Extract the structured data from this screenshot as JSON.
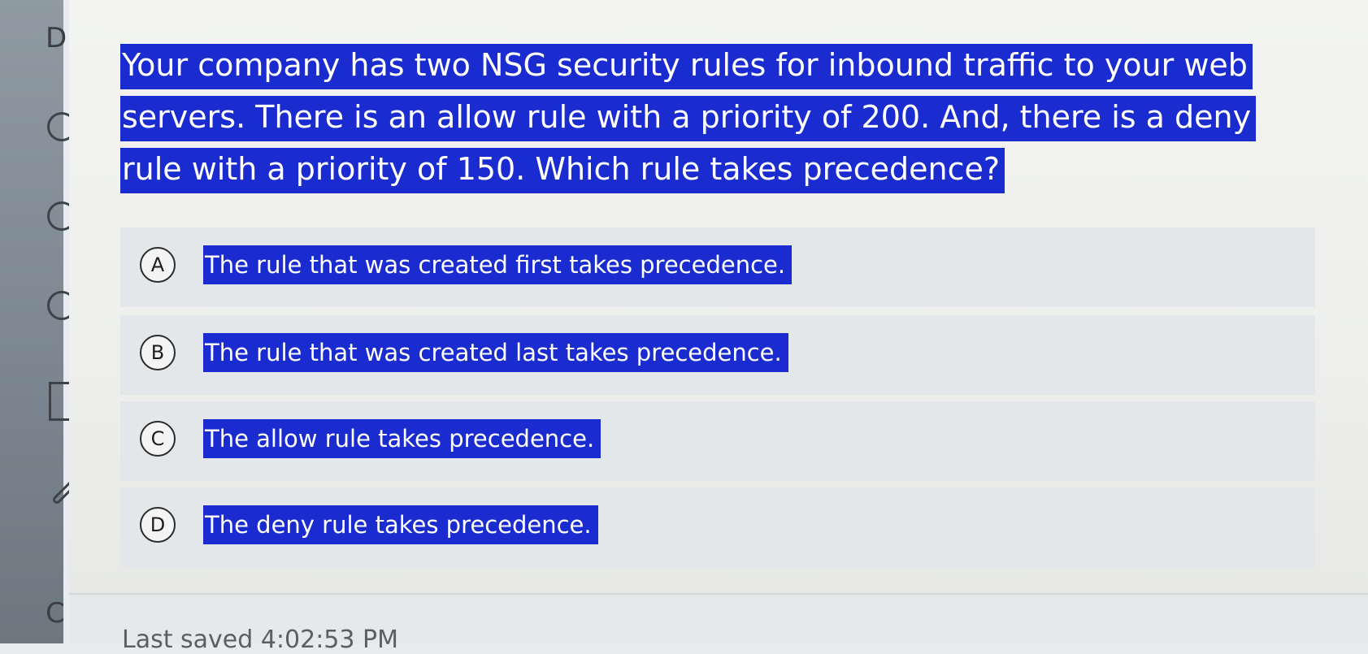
{
  "rail": {
    "top_letter": "D",
    "bottom_letter": "C"
  },
  "question": {
    "text": "Your company has two NSG security rules for inbound traffic to your web servers. There is an allow rule with a priority of 200. And, there is a deny rule with a priority of 150. Which rule takes precedence?"
  },
  "options": [
    {
      "letter": "A",
      "text": "The rule that was created first takes precedence."
    },
    {
      "letter": "B",
      "text": "The rule that was created last takes precedence."
    },
    {
      "letter": "C",
      "text": "The allow rule takes precedence."
    },
    {
      "letter": "D",
      "text": "The deny rule takes precedence."
    }
  ],
  "footer": {
    "status": "Last saved 4:02:53 PM"
  },
  "colors": {
    "selection": "#1a2ccf",
    "panel": "#f3f4f2",
    "option_bg": "#e4e7ea"
  }
}
